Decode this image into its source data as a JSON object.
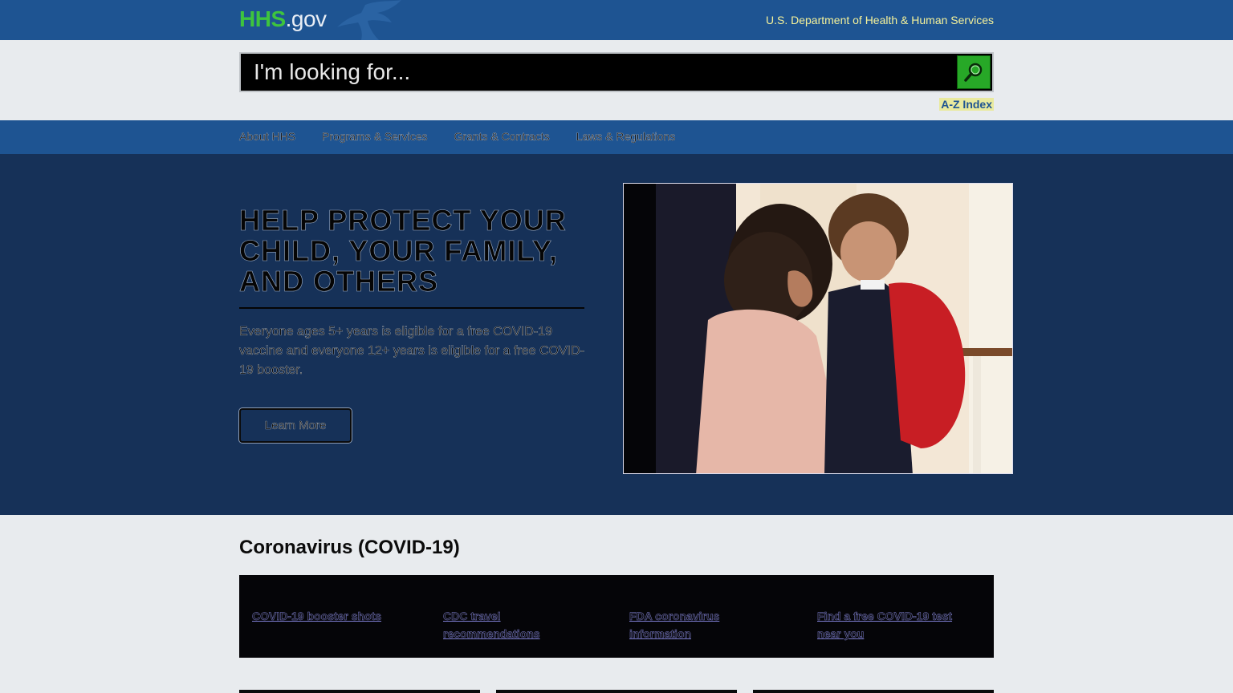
{
  "header": {
    "logo_main": "HHS",
    "logo_suffix": ".gov",
    "department": "U.S. Department of Health & Human Services"
  },
  "search": {
    "placeholder": "I'm looking for...",
    "value": "",
    "az_index": "A-Z Index"
  },
  "nav": {
    "items": [
      {
        "label": "About HHS"
      },
      {
        "label": "Programs & Services"
      },
      {
        "label": "Grants & Contracts"
      },
      {
        "label": "Laws & Regulations"
      }
    ]
  },
  "hero": {
    "title": "HELP PROTECT YOUR CHILD, YOUR FAMILY, AND OTHERS",
    "body": "Everyone ages 5+ years is eligible for a free COVID-19 vaccine and everyone 12+ years is eligible for a free COVID-19 booster.",
    "button": "Learn More"
  },
  "covid": {
    "title": "Coronavirus (COVID-19)",
    "links": [
      {
        "label": "COVID-19 booster shots"
      },
      {
        "label": "CDC travel recommendations"
      },
      {
        "label": "FDA coronavirus information"
      },
      {
        "label": "Find a free COVID-19 test near you"
      }
    ]
  },
  "colors": {
    "topbar": "#1e5492",
    "hero_bg": "#163158",
    "logo_green": "#3ec43e",
    "search_button": "#27a827"
  }
}
